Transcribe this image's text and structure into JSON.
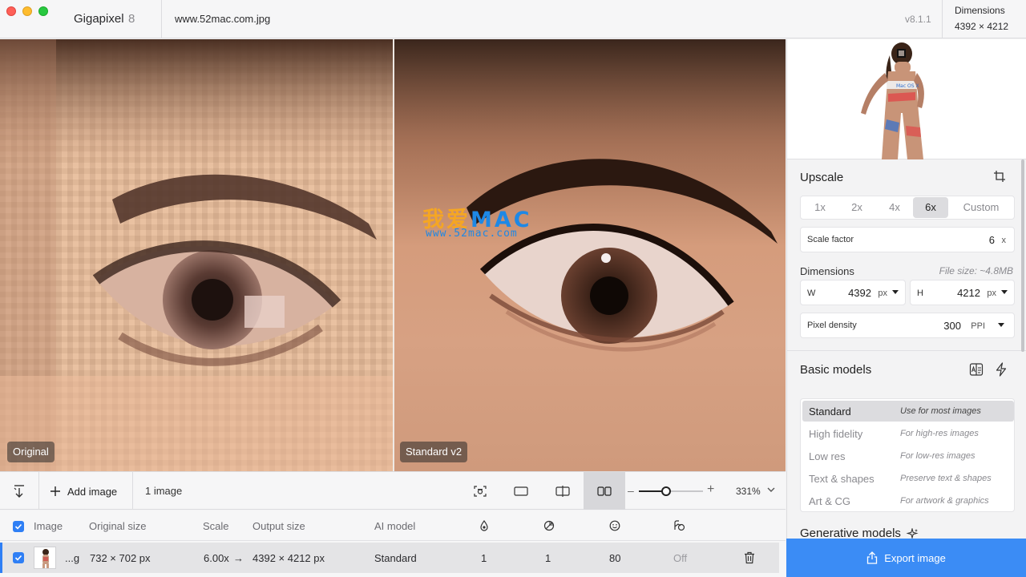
{
  "window": {
    "app_name": "Gigapixel",
    "app_version": "8",
    "file_name": "www.52mac.com.jpg",
    "build_version": "v8.1.1",
    "dimensions_label": "Dimensions",
    "dimensions_value": "4392 × 4212"
  },
  "preview": {
    "left_label": "Original",
    "right_label": "Standard v2",
    "watermark_main": "我爱",
    "watermark_mac": "MAC",
    "watermark_url": "www.52mac.com"
  },
  "toolbar": {
    "add_image_label": "Add image",
    "image_count": "1 image",
    "zoom_minus": "–",
    "zoom_plus": "+",
    "zoom_level": 0.42,
    "zoom_value": "331%"
  },
  "table": {
    "headers": {
      "image": "Image",
      "original_size": "Original size",
      "scale": "Scale",
      "output_size": "Output size",
      "ai_model": "AI model"
    },
    "rows": [
      {
        "name": "...g",
        "original_size": "732 × 702 px",
        "scale": "6.00x",
        "arrow": "→",
        "output_size": "4392 × 4212 px",
        "ai_model": "Standard",
        "denoise": "1",
        "sharpen": "1",
        "face_recovery": "80",
        "gamma": "Off"
      }
    ]
  },
  "panel": {
    "upscale_title": "Upscale",
    "scale_options": [
      "1x",
      "2x",
      "4x",
      "6x",
      "Custom"
    ],
    "scale_selected": "6x",
    "scale_factor_label": "Scale factor",
    "scale_factor_value": "6",
    "scale_factor_unit": "x",
    "dimensions_title": "Dimensions",
    "file_size": "File size: ~4.8MB",
    "width_label": "W",
    "width_value": "4392",
    "width_unit": "px",
    "height_label": "H",
    "height_value": "4212",
    "height_unit": "px",
    "density_label": "Pixel density",
    "density_value": "300",
    "density_unit": "PPI",
    "basic_models_title": "Basic models",
    "models": [
      {
        "name": "Standard",
        "desc": "Use for most images"
      },
      {
        "name": "High fidelity",
        "desc": "For high-res images"
      },
      {
        "name": "Low res",
        "desc": "For low-res images"
      },
      {
        "name": "Text & shapes",
        "desc": "Preserve text & shapes"
      },
      {
        "name": "Art & CG",
        "desc": "For artwork & graphics"
      }
    ],
    "generative_models_title": "Generative models",
    "export_label": "Export image"
  },
  "colors": {
    "accent": "#3b8cf5",
    "close": "#fe5f57",
    "minimize": "#febc2e",
    "maximize": "#28c840"
  }
}
